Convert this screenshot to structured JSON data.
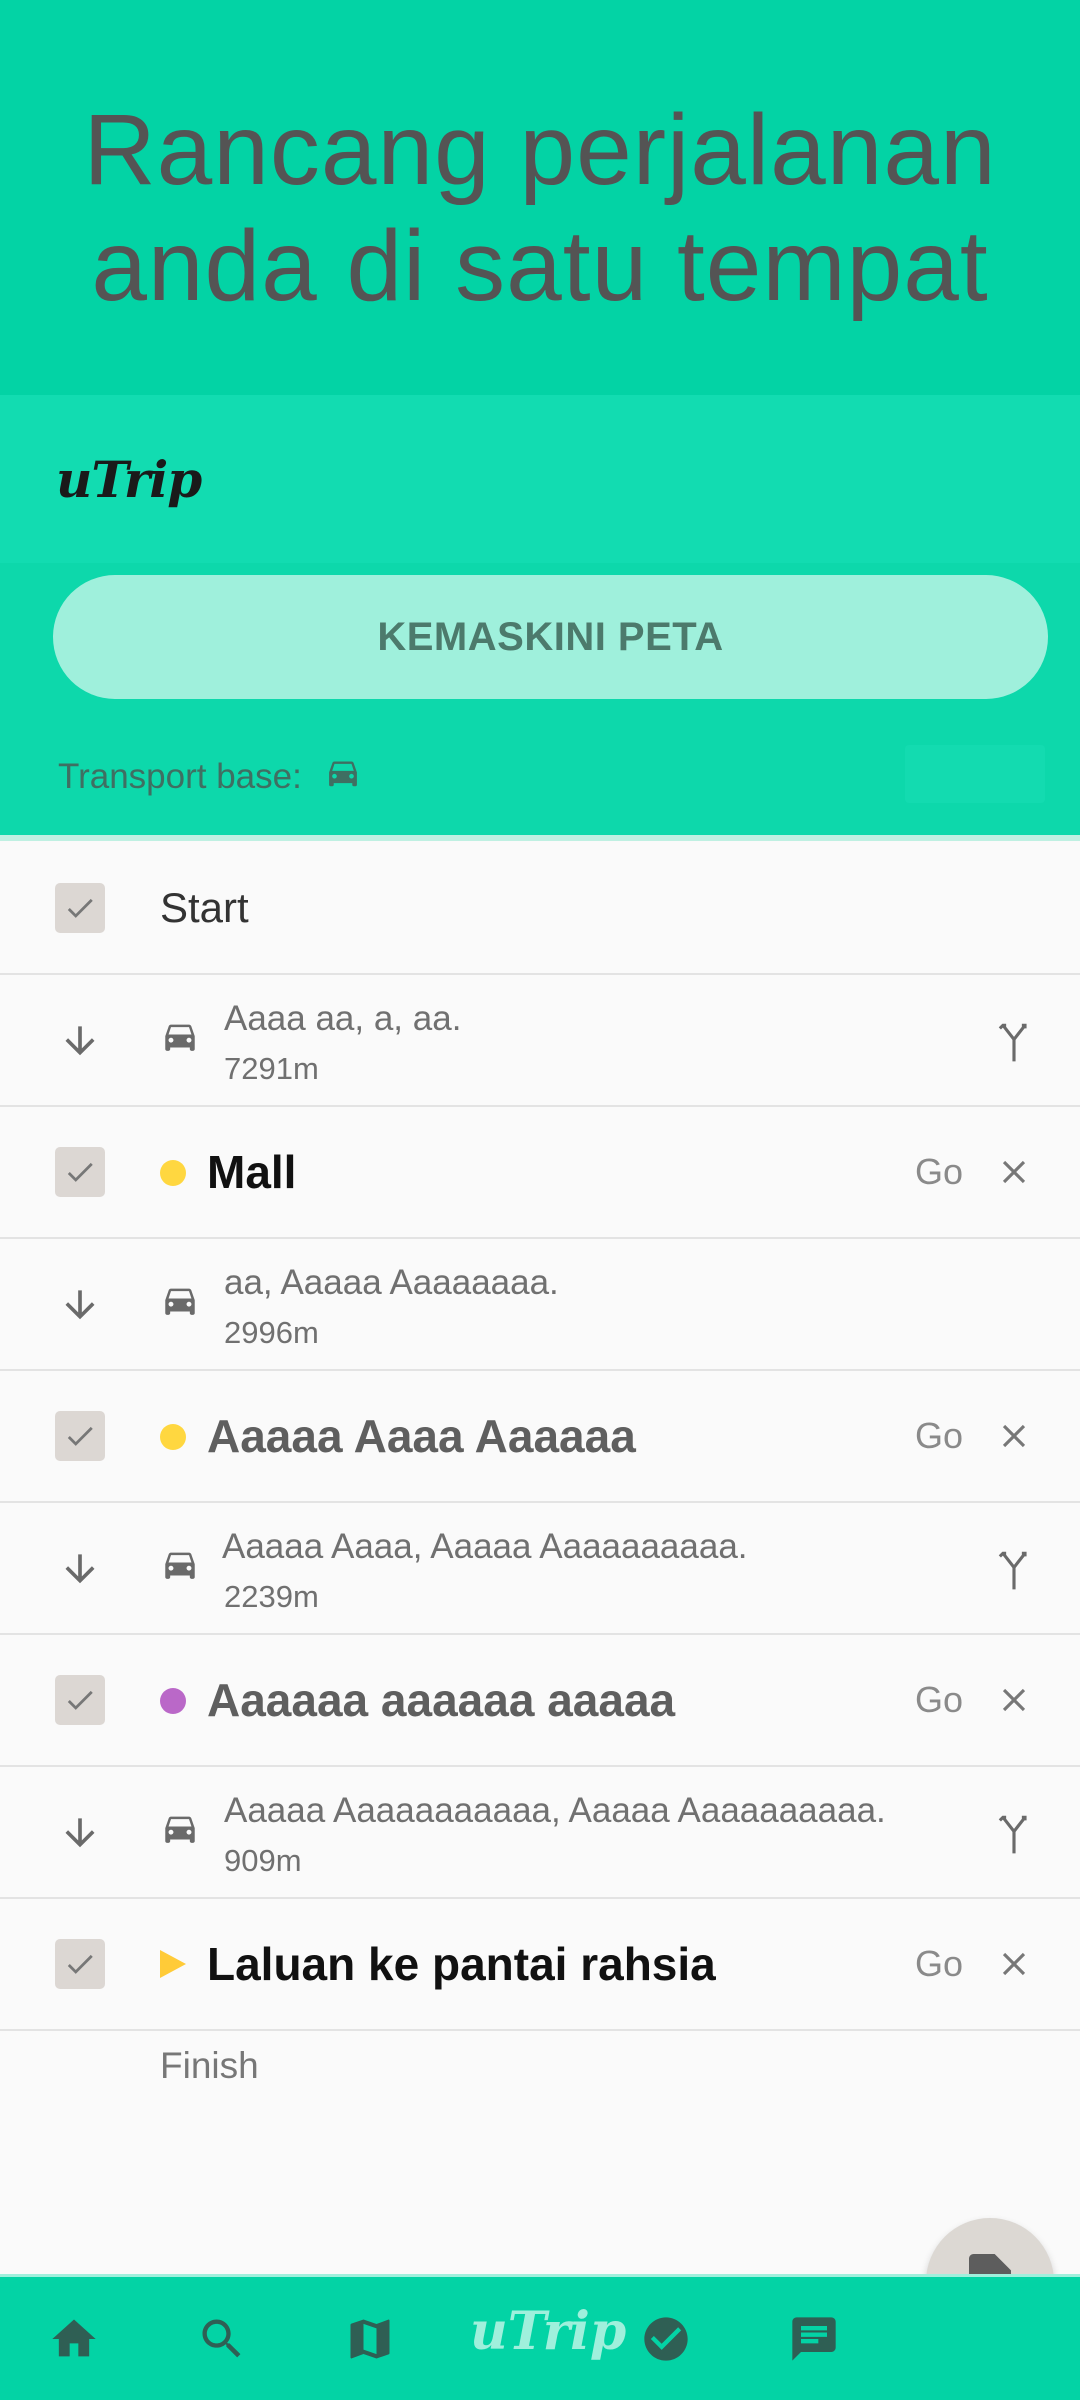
{
  "hero": {
    "title_line1": "Rancang perjalanan",
    "title_line2": "anda di satu tempat"
  },
  "panel": {
    "logo": "uTrip",
    "update_button": "KEMASKINI PETA",
    "transport_label": "Transport base:",
    "transport_icon": "car-icon"
  },
  "itinerary": {
    "start": "Start",
    "finish": "Finish",
    "stops": [
      {
        "name": "Mall",
        "marker": "dot",
        "marker_color": "#ffd740",
        "emphasis": "dark",
        "go": "Go"
      },
      {
        "name": "Aaaaa Aaaa Aaaaaa",
        "marker": "dot",
        "marker_color": "#ffd740",
        "emphasis": "grey",
        "go": "Go"
      },
      {
        "name": "Aaaaaa aaaaaa aaaaa",
        "marker": "dot",
        "marker_color": "#ba68c8",
        "emphasis": "grey",
        "go": "Go"
      },
      {
        "name": "Laluan ke pantai rahsia",
        "marker": "triangle",
        "marker_color": "#ffcb38",
        "emphasis": "dark",
        "go": "Go"
      }
    ],
    "segments": [
      {
        "route": "Aaaa aa, a, aa.",
        "distance": "7291m",
        "fork": true
      },
      {
        "route": "aa, Aaaaa Aaaaaaaa.",
        "distance": "2996m",
        "fork": false
      },
      {
        "route": "Aaaaa Aaaa, Aaaaa Aaaaaaaaaa.",
        "distance": "2239m",
        "fork": true
      },
      {
        "route": "Aaaaa Aaaaaaaaaaa, Aaaaa Aaaaaaaaaa.",
        "distance": "909m",
        "fork": true
      }
    ]
  },
  "fab": {
    "icon": "contact-document-icon"
  },
  "navbar": {
    "logo": "uTrip",
    "items": [
      "home-icon",
      "search-icon",
      "map-icon",
      "check-circle-icon",
      "chat-icon"
    ]
  },
  "colors": {
    "primary": "#03d3a5",
    "accent_light": "#9ff0dc",
    "panel": "#0dd8ab"
  }
}
